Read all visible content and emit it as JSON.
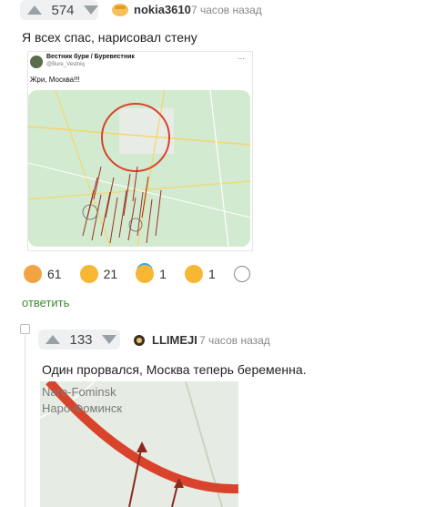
{
  "comment1": {
    "score": "574",
    "username": "nokia3610",
    "time": "7 часов назад",
    "text": "Я всех спас, нарисовал стену",
    "tweet": {
      "author": "Вестник бури / Буревестник",
      "handle": "@Bure_Vestniq",
      "text": "Жри, Москва!!!"
    },
    "reactions": [
      {
        "icon": "clap-icon",
        "count": "61"
      },
      {
        "icon": "laugh-tears-icon",
        "count": "21"
      },
      {
        "icon": "halo-face-icon",
        "count": "1"
      },
      {
        "icon": "rofl-icon",
        "count": "1"
      }
    ],
    "reply_label": "ответить"
  },
  "comment2": {
    "score": "133",
    "username": "LLIMEJI",
    "time": "7 часов назад",
    "text": "Один прорвался, Москва теперь беременна.",
    "map_labels": {
      "latin": "Naro-Fominsk",
      "cyrillic": "Наро-Фоминск"
    }
  },
  "colors": {
    "accent_green": "#3a8f2f",
    "circle_red": "#d9432b",
    "map_green": "#cfe8c8"
  }
}
